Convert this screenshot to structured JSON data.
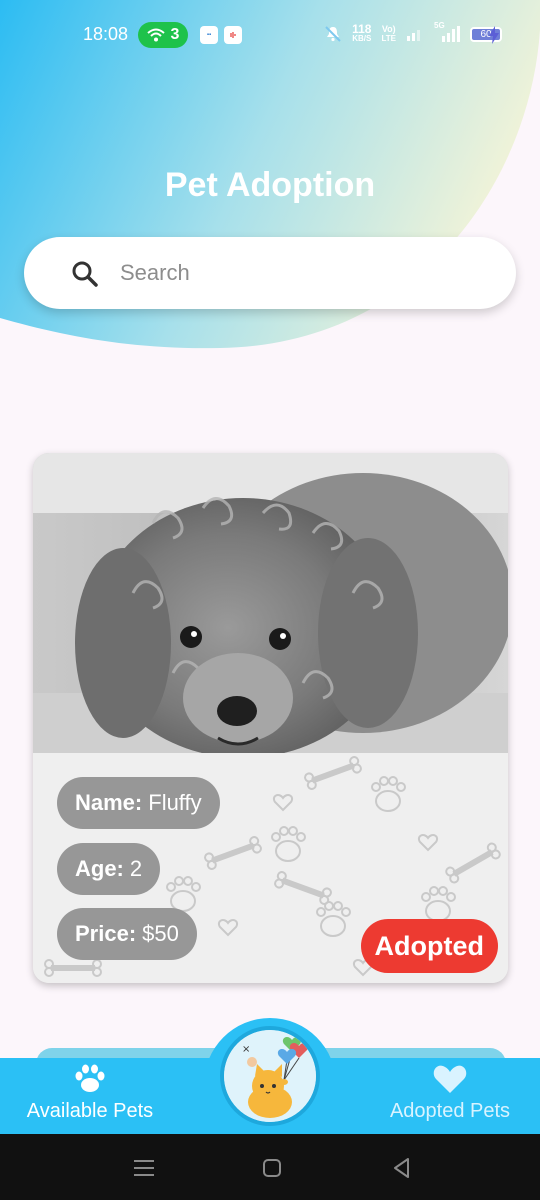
{
  "status_bar": {
    "time": "18:08",
    "hotspot_count": "3",
    "net_speed_value": "118",
    "net_speed_unit": "KB/S",
    "volte_top": "Vo)",
    "volte_bottom": "LTE",
    "network_label": "5G",
    "battery_level": "60"
  },
  "header": {
    "title": "Pet Adoption"
  },
  "search": {
    "placeholder": "Search",
    "value": ""
  },
  "pet_card": {
    "name_label": "Name:",
    "name_value": "Fluffy",
    "age_label": "Age:",
    "age_value": "2",
    "price_label": "Price:",
    "price_value": "$50",
    "status": "Adopted"
  },
  "bottom_nav": {
    "available_label": "Available Pets",
    "adopted_label": "Adopted Pets"
  },
  "colors": {
    "primary": "#2bc0f5",
    "adopted_badge": "#ed3a31",
    "info_pill": "#979797",
    "background": "#fcf6fb"
  }
}
